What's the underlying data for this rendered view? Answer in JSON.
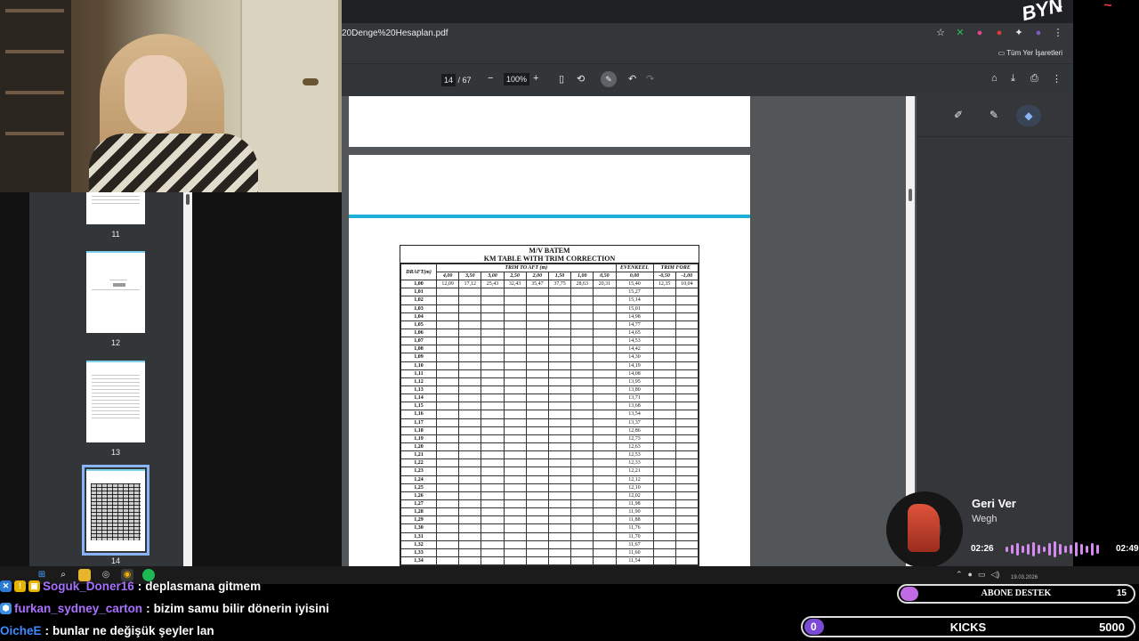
{
  "browser": {
    "url": "20Denge%20Hesaplan.pdf",
    "bookmarks_label": "Tüm Yer İşaretleri"
  },
  "pdf_toolbar": {
    "page_current": "14",
    "page_total": "/ 67",
    "zoom": "100%"
  },
  "thumbnails": [
    {
      "num": "11"
    },
    {
      "num": "12"
    },
    {
      "num": "13"
    },
    {
      "num": "14",
      "selected": true
    }
  ],
  "km_table": {
    "title1": "M/V BATEM",
    "title2": "KM TABLE WITH TRIM CORRECTION",
    "draft_header": "DRAFT(m)",
    "trim_aft_header": "TRIM TO AFT (m)",
    "evenkeel_header": "EVENKEEL",
    "trim_fore_header": "TRIM FORE",
    "trim_aft_values": [
      "4,00",
      "3,50",
      "3,00",
      "2,50",
      "2,00",
      "1,50",
      "1,00",
      "0,50"
    ],
    "evenkeel_value": "0,00",
    "trim_fore_values": [
      "-0,50",
      "-1,00"
    ],
    "first_row": [
      "12,09",
      "17,12",
      "25,43",
      "32,43",
      "35,47",
      "37,75",
      "28,63",
      "20,31",
      "15,40",
      "12,35",
      "10,04"
    ],
    "drafts": [
      "1,00",
      "1,01",
      "1,02",
      "1,03",
      "1,04",
      "1,05",
      "1,06",
      "1,07",
      "1,08",
      "1,09",
      "1,10",
      "1,11",
      "1,12",
      "1,13",
      "1,14",
      "1,15",
      "1,16",
      "1,17",
      "1,18",
      "1,19",
      "1,20",
      "1,21",
      "1,22",
      "1,23",
      "1,24",
      "1,25",
      "1,26",
      "1,27",
      "1,28",
      "1,29",
      "1,30",
      "1,31",
      "1,32",
      "1,33",
      "1,34"
    ],
    "evenkeel_col": [
      "15,40",
      "15,27",
      "15,14",
      "15,01",
      "14,98",
      "14,77",
      "14,65",
      "14,53",
      "14,42",
      "14,30",
      "14,19",
      "14,08",
      "13,95",
      "13,80",
      "13,71",
      "13,68",
      "13,54",
      "13,37",
      "12,86",
      "12,73",
      "12,63",
      "12,53",
      "12,33",
      "12,21",
      "12,12",
      "12,10",
      "12,02",
      "11,98",
      "11,90",
      "11,88",
      "11,76",
      "11,70",
      "11,67",
      "11,60",
      "11,54"
    ]
  },
  "music": {
    "title": "Geri Ver",
    "artist": "Wegh",
    "time_current": "02:26",
    "time_total": "02:49",
    "progress": 0.86
  },
  "chat": [
    {
      "user": "Soguk_Doner16",
      "text": "deplasmana gitmem",
      "color": "#a970ff"
    },
    {
      "user": "furkan_sydney_carton",
      "text": "bizim samu bilir dönerin iyisini",
      "color": "#a970ff"
    },
    {
      "user": "OicheE",
      "text": "bunlar ne değişük şeyler lan",
      "color": "#3d8bff"
    }
  ],
  "goals": {
    "abone_label": "ABONE DESTEK",
    "abone_value": "15",
    "kicks_current": "0",
    "kicks_label": "KICKS",
    "kicks_value": "5000"
  },
  "taskbar": {
    "date": "19.03.2026"
  },
  "overlay": {
    "logo_text": "BYN"
  },
  "colors": {
    "accent_blue": "#8ab4f8",
    "page_bar": "#1fb0d8",
    "chat_purple": "#a970ff",
    "music_wave": "#d58af0"
  }
}
